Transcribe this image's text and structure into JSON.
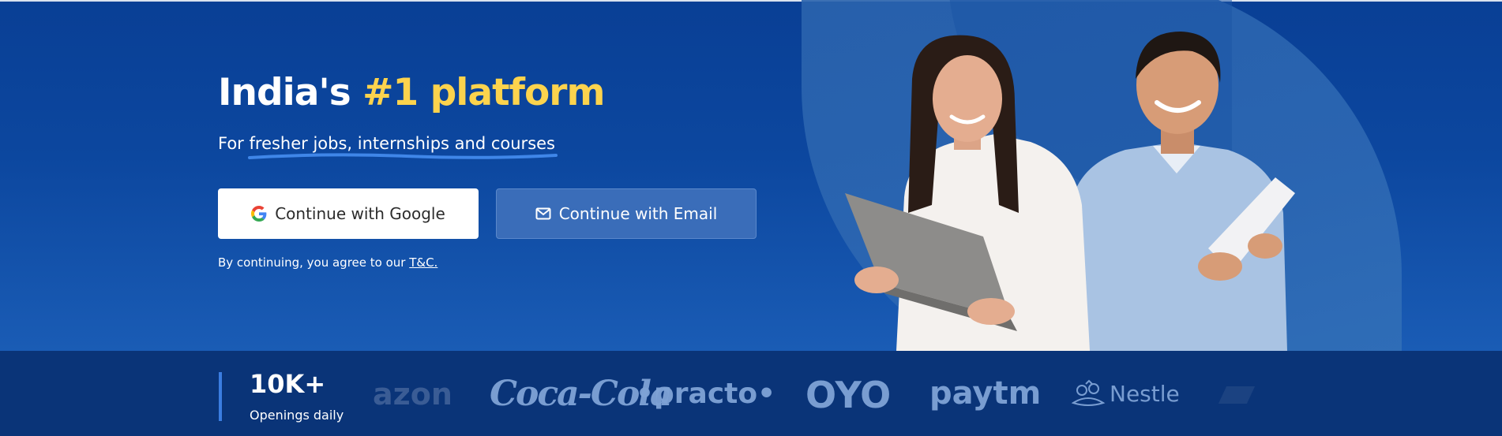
{
  "hero": {
    "headline_prefix": "India's ",
    "headline_accent": "#1 platform",
    "subtitle_prefix": "For ",
    "subtitle_highlight": "fresher jobs, internships and courses",
    "google_button_label": "Continue with Google",
    "email_button_label": "Continue with Email",
    "terms_prefix": "By continuing, you agree to our ",
    "terms_link": "T&C.",
    "accent_color": "#fcd34d",
    "background_color": "#0c479f"
  },
  "stats": {
    "value": "10K+",
    "label": "Openings daily"
  },
  "logos": {
    "amazon": "azon",
    "cocacola": "Coca-Cola",
    "practo": "•practo•",
    "oyo": "OYO",
    "paytm": "paytm",
    "nestle": "Nestle"
  },
  "icons": {
    "google": "google-icon",
    "email": "mail-icon"
  }
}
